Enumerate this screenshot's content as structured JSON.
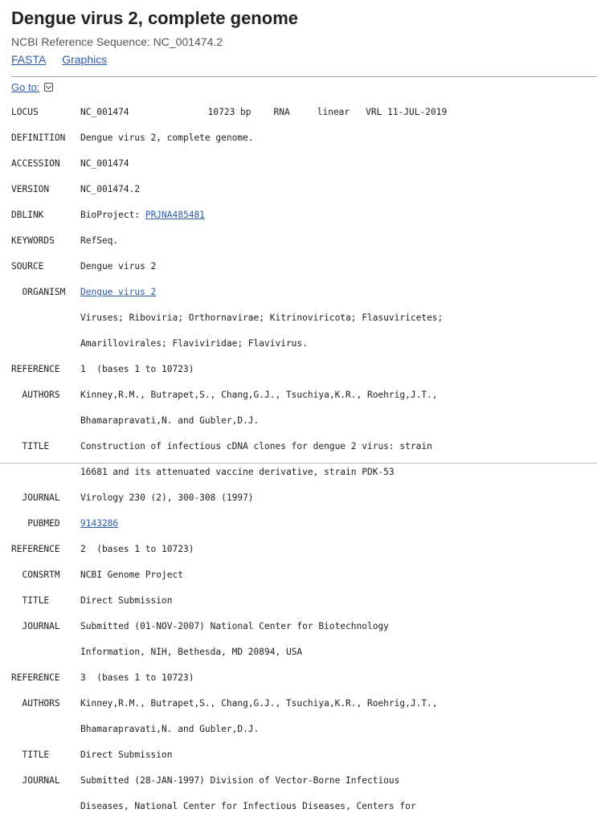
{
  "header": {
    "title": "Dengue virus 2, complete genome",
    "subtitle": "NCBI Reference Sequence: NC_001474.2",
    "links": [
      "FASTA",
      "Graphics"
    ],
    "goto_label": "Go to:"
  },
  "record": {
    "locus": {
      "key": "LOCUS",
      "name": "NC_001474",
      "length": "10723 bp",
      "moltype": "RNA",
      "topology": "linear",
      "division_date": "VRL 11-JUL-2019"
    },
    "definition": {
      "key": "DEFINITION",
      "value": "Dengue virus 2, complete genome."
    },
    "accession": {
      "key": "ACCESSION",
      "value": "NC_001474"
    },
    "version": {
      "key": "VERSION",
      "value": "NC_001474.2"
    },
    "dblink": {
      "key": "DBLINK",
      "prefix": "BioProject: ",
      "link": "PRJNA485481"
    },
    "keywords": {
      "key": "KEYWORDS",
      "value": "RefSeq."
    },
    "source": {
      "key": "SOURCE",
      "value": "Dengue virus 2"
    },
    "organism": {
      "key": "ORGANISM",
      "link": "Dengue virus 2",
      "lineage": [
        "Viruses; Riboviria; Orthornavirae; Kitrinoviricota; Flasuviricetes;",
        "Amarillovirales; Flaviviridae; Flavivirus."
      ]
    },
    "ref1": {
      "key": "REFERENCE",
      "value": "1  (bases 1 to 10723)",
      "authors_key": "AUTHORS",
      "authors": [
        "Kinney,R.M., Butrapet,S., Chang,G.J., Tsuchiya,K.R., Roehrig,J.T.,",
        "Bhamarapravati,N. and Gubler,D.J."
      ],
      "title_key": "TITLE",
      "title": [
        "Construction of infectious cDNA clones for dengue 2 virus: strain",
        "16681 and its attenuated vaccine derivative, strain PDK-53"
      ],
      "journal_key": "JOURNAL",
      "journal": "Virology 230 (2), 300-308 (1997)",
      "pubmed_key": "PUBMED",
      "pubmed": "9143286"
    },
    "ref2": {
      "key": "REFERENCE",
      "value": "2  (bases 1 to 10723)",
      "consrtm_key": "CONSRTM",
      "consrtm": "NCBI Genome Project",
      "title_key": "TITLE",
      "title": "Direct Submission",
      "journal_key": "JOURNAL",
      "journal": [
        "Submitted (01-NOV-2007) National Center for Biotechnology",
        "Information, NIH, Bethesda, MD 20894, USA"
      ]
    },
    "ref3": {
      "key": "REFERENCE",
      "value": "3  (bases 1 to 10723)",
      "authors_key": "AUTHORS",
      "authors": [
        "Kinney,R.M., Butrapet,S., Chang,G.J., Tsuchiya,K.R., Roehrig,J.T.,",
        "Bhamarapravati,N. and Gubler,D.J."
      ],
      "title_key": "TITLE",
      "title": "Direct Submission",
      "journal_key": "JOURNAL",
      "journal": [
        "Submitted (28-JAN-1997) Division of Vector-Borne Infectious",
        "Diseases, National Center for Infectious Diseases, Centers for"
      ]
    }
  },
  "colors": {
    "link": "#2d5ba5",
    "text": "#222222",
    "subtitle": "#555555",
    "rule": "#97a3b5"
  },
  "icons": {
    "goto": "chevron-down-icon"
  }
}
